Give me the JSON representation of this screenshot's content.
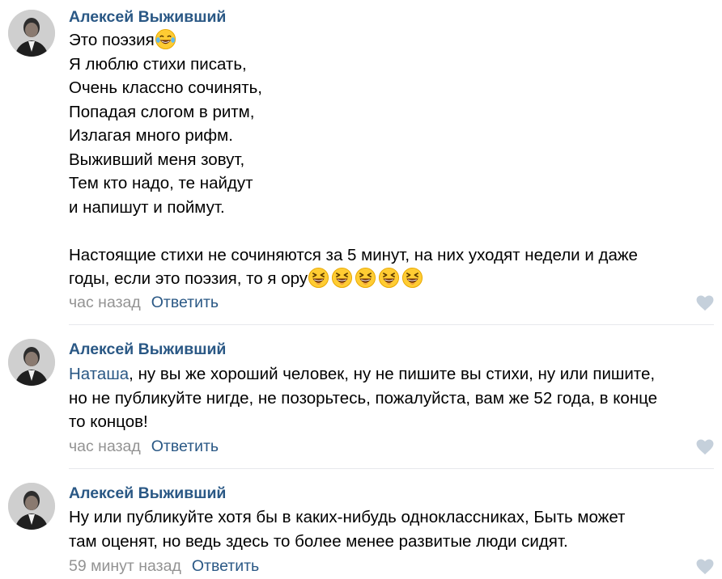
{
  "comments": [
    {
      "author": "Алексей Выживший",
      "lines": [
        "Это поэзия",
        "Я люблю стихи писать,",
        "Очень классно сочинять,",
        "Попадая слогом в ритм,",
        "Излагая много рифм.",
        "Выживший меня зовут,",
        "Тем кто надо, те найдут",
        "и напишут и поймут.",
        "",
        "Настоящие стихи не сочиняются за 5 минут, на них уходят недели и даже",
        "годы, если это поэзия, то я ору"
      ],
      "emoji_first_line": "tears-of-joy-emoji",
      "emoji_last_line": "laughing-emoji",
      "time": "час назад",
      "reply": "Ответить"
    },
    {
      "author": "Алексей Выживший",
      "mention": "Наташа",
      "lines": [
        ", ну вы же хороший человек, ну не пишите вы стихи, ну или пишите,",
        "но не публикуйте нигде, не позорьтесь, пожалуйста, вам же 52 года, в конце",
        "то концов!"
      ],
      "time": "час назад",
      "reply": "Ответить"
    },
    {
      "author": "Алексей Выживший",
      "lines": [
        "Ну или публикуйте хотя бы в каких-нибудь одноклассниках, Быть может",
        "там оценят, но ведь здесь то более менее развитые люди сидят."
      ],
      "time": "59 минут назад",
      "reply": "Ответить"
    }
  ],
  "colors": {
    "link": "#2a5885",
    "meta": "#939393",
    "divider": "#e7e8ec",
    "like": "#c5d0db"
  },
  "icons": {
    "like": "heart-icon",
    "avatar": "user-avatar"
  }
}
